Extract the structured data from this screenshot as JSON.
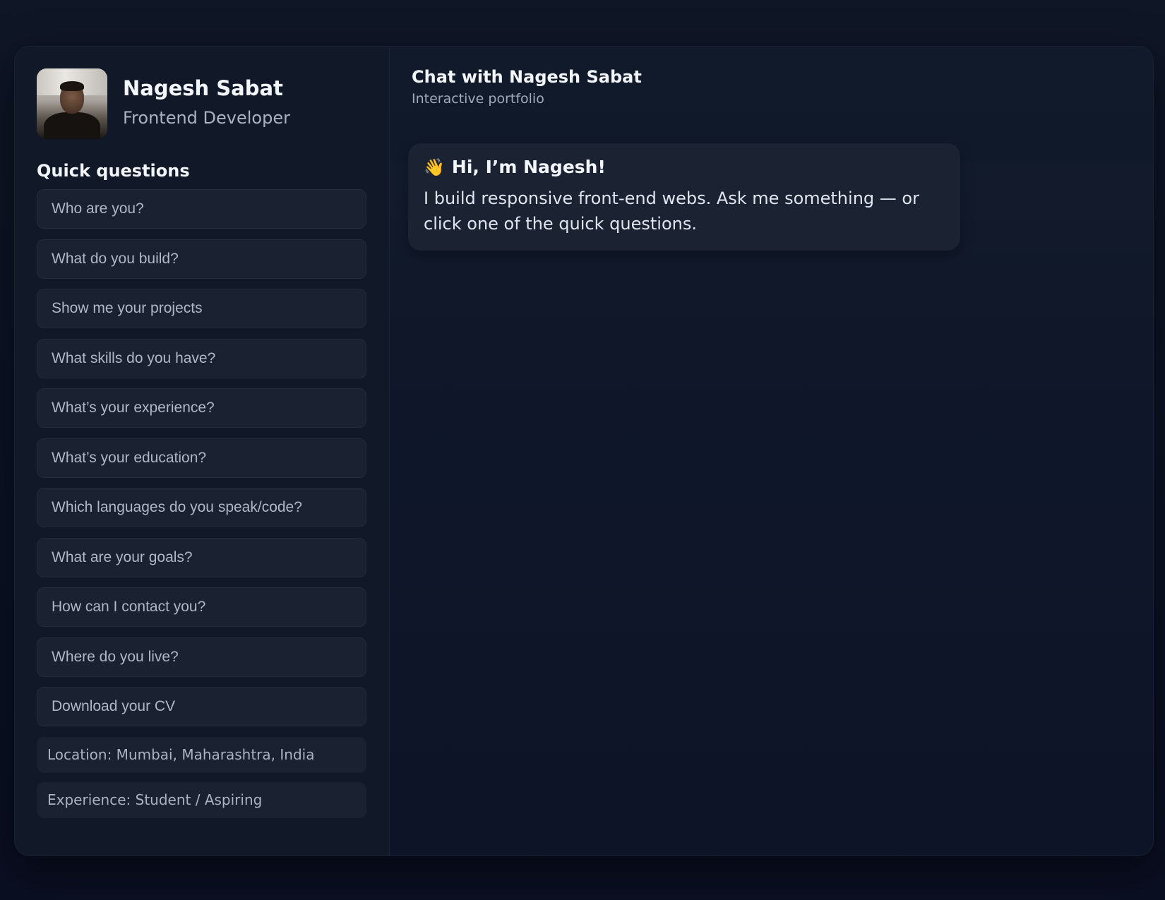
{
  "profile": {
    "name": "Nagesh Sabat",
    "role": "Frontend Developer"
  },
  "sidebar": {
    "quick_questions_title": "Quick questions",
    "questions": [
      {
        "label": "Who are you?"
      },
      {
        "label": "What do you build?"
      },
      {
        "label": "Show me your projects"
      },
      {
        "label": "What skills do you have?"
      },
      {
        "label": "What’s your experience?"
      },
      {
        "label": "What’s your education?"
      },
      {
        "label": "Which languages do you speak/code?"
      },
      {
        "label": "What are your goals?"
      },
      {
        "label": "How can I contact you?"
      },
      {
        "label": "Where do you live?"
      },
      {
        "label": "Download your CV"
      }
    ],
    "info": {
      "location": "Location: Mumbai, Maharashtra, India",
      "experience": "Experience: Student / Aspiring"
    }
  },
  "chat": {
    "title": "Chat with Nagesh Sabat",
    "subtitle": "Interactive portfolio",
    "messages": [
      {
        "icon": "👋",
        "title": "Hi, I’m Nagesh!",
        "text": "I build responsive front-end webs. Ask me something — or click one of the quick questions."
      }
    ]
  },
  "colors": {
    "background": "#0b1224",
    "panel": "#111827",
    "card": "#1a2130",
    "text_primary": "#f3f6fa",
    "text_secondary": "#a9b3c2"
  }
}
